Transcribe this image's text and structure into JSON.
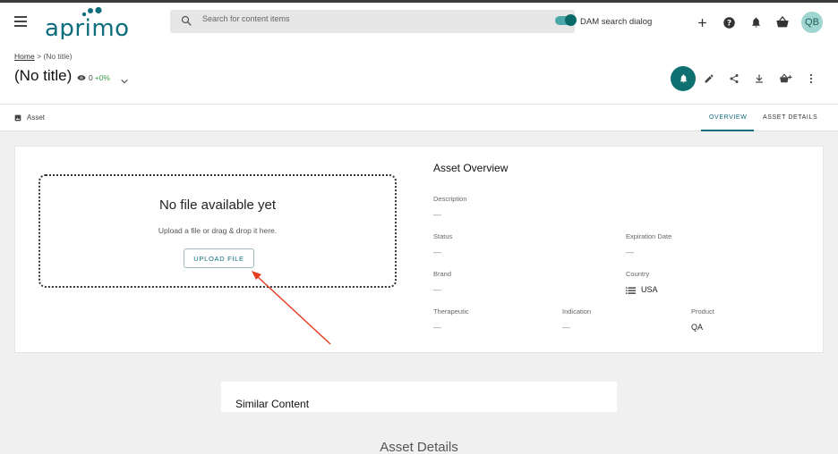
{
  "app": {
    "logo_text": "aprimo",
    "brand_color": "#0e6e7e"
  },
  "topbar": {
    "menu_icon": "hamburger-menu-icon",
    "search_placeholder": "Search for content items",
    "toggle_label": "DAM search dialog",
    "toggle_on": true,
    "icons": [
      "plus-icon",
      "help-icon",
      "bell-icon",
      "basket-icon"
    ],
    "avatar_initials": "QB"
  },
  "header": {
    "breadcrumb_home": "Home",
    "breadcrumb_sep": ">",
    "breadcrumb_current": "(No title)",
    "title": "(No title)",
    "views_count": "0",
    "views_change": "+0%",
    "actions": [
      "bell-icon",
      "edit-icon",
      "share-icon",
      "download-icon",
      "add-to-basket-icon",
      "more-vertical-icon"
    ]
  },
  "tabs": {
    "asset_label": "Asset",
    "items": [
      {
        "label": "OVERVIEW",
        "active": true
      },
      {
        "label": "ASSET DETAILS",
        "active": false
      }
    ]
  },
  "dropzone": {
    "title": "No file available yet",
    "subtitle": "Upload a file or drag & drop it here.",
    "button": "UPLOAD FILE"
  },
  "overview": {
    "title": "Asset Overview",
    "fields": {
      "description": {
        "label": "Description",
        "value": "—"
      },
      "status": {
        "label": "Status",
        "value": "—"
      },
      "expiration": {
        "label": "Expiration Date",
        "value": "—"
      },
      "brand": {
        "label": "Brand",
        "value": "—"
      },
      "country": {
        "label": "Country",
        "value": "USA"
      },
      "therapeutic": {
        "label": "Therapeutic",
        "value": "—"
      },
      "indication": {
        "label": "Indication",
        "value": "—"
      },
      "product": {
        "label": "Product",
        "value": "QA"
      }
    }
  },
  "similar": {
    "title": "Similar Content"
  },
  "asset_details": {
    "title": "Asset Details"
  },
  "annotation": {
    "arrow_color": "#e53a1e"
  }
}
